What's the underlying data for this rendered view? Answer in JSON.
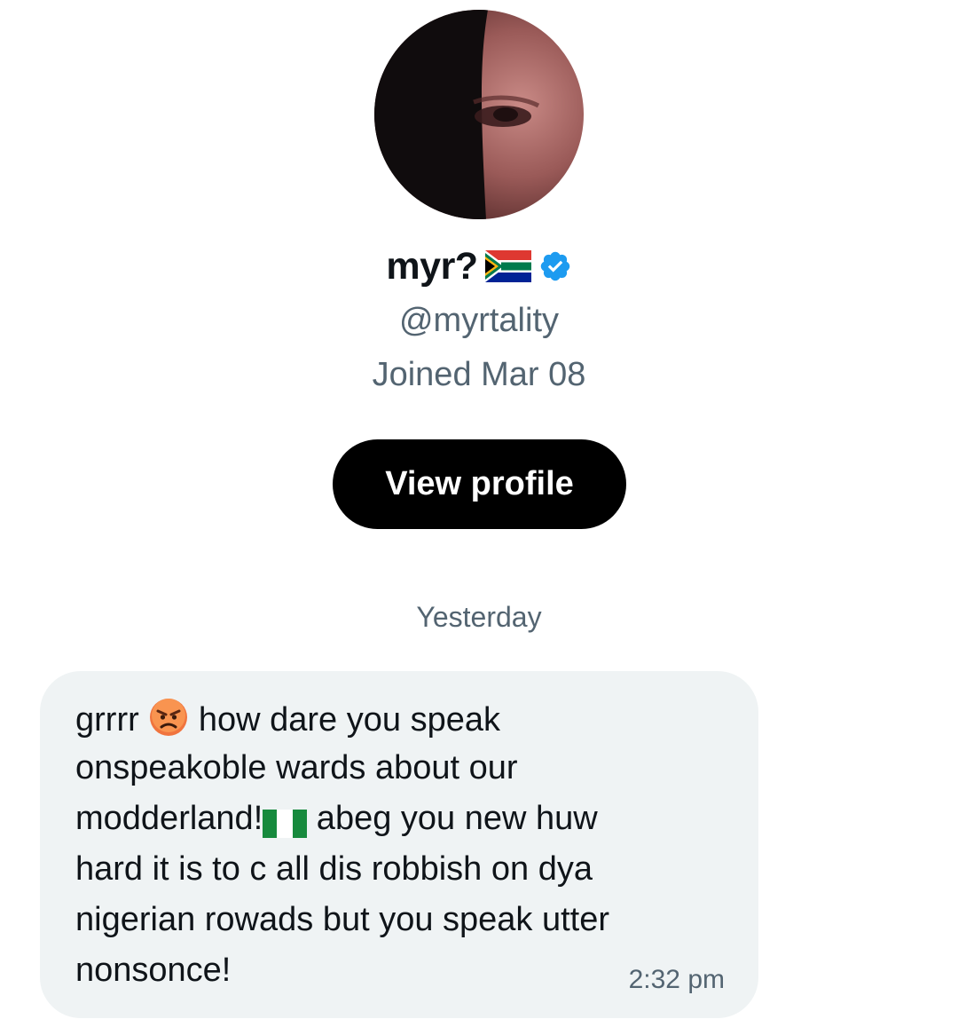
{
  "profile": {
    "display_name": "myr?",
    "flag_emoji_icon": "south-africa-flag-icon",
    "verified_icon": "verified-badge-icon",
    "verified_color": "#1d9bf0",
    "handle": "@myrtality",
    "joined": "Joined Mar 08",
    "view_profile_label": "View profile"
  },
  "conversation": {
    "date_separator": "Yesterday",
    "message": {
      "lines": [
        {
          "before": "grrrr ",
          "after": " how dare you speak"
        },
        {
          "before": "onspeakoble wards about our",
          "after": ""
        },
        {
          "before": "modderland!",
          "after": " abeg you new huw"
        },
        {
          "before": "hard it is to c all dis robbish on dya",
          "after": ""
        },
        {
          "before": "nigerian rowads but you speak utter",
          "after": ""
        },
        {
          "before": "nonsonce!",
          "after": ""
        }
      ],
      "emoji_icons": [
        "angry-face-icon",
        "nigeria-flag-icon"
      ],
      "time": "2:32 pm",
      "bubble_color": "#eff3f4"
    }
  }
}
